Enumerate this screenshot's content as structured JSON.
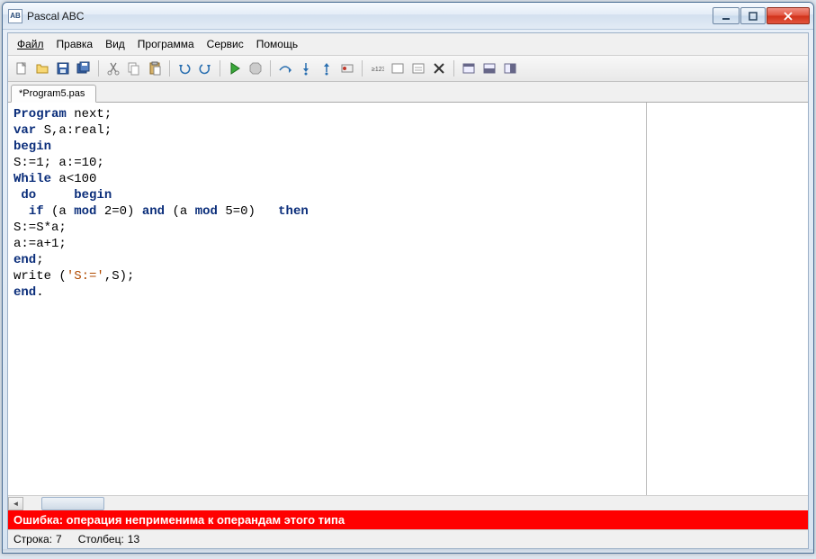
{
  "title": "Pascal ABC",
  "app_icon_text": "AB",
  "menu": {
    "file": "Файл",
    "edit": "Правка",
    "view": "Вид",
    "program": "Программа",
    "service": "Сервис",
    "help": "Помощь"
  },
  "tab": {
    "label": "*Program5.pas"
  },
  "toolbar_icons": {
    "new": "new-file-icon",
    "open": "open-folder-icon",
    "save": "save-icon",
    "saveall": "save-all-icon",
    "cut": "cut-icon",
    "copy": "copy-icon",
    "paste": "paste-icon",
    "undo": "undo-icon",
    "redo": "redo-icon",
    "run": "run-icon",
    "stop": "stop-icon",
    "stepover": "step-over-icon",
    "stepinto": "step-into-icon",
    "stepout": "step-out-icon",
    "breakpoint": "breakpoint-icon",
    "tracevar": "trace-var-icon",
    "showtextwin": "show-text-window-icon",
    "showgraphwin": "show-graph-window-icon",
    "closewins": "close-windows-icon",
    "out1": "output-window-1-icon",
    "out2": "output-window-2-icon",
    "out3": "output-window-3-icon"
  },
  "code_tokens": [
    [
      [
        "kw",
        "Program"
      ],
      [
        "",
        " next;"
      ]
    ],
    [
      [
        "kw",
        "var"
      ],
      [
        "",
        " S,a:real;"
      ]
    ],
    [
      [
        "kw",
        "begin"
      ]
    ],
    [
      [
        "",
        "S:=1; a:=10;"
      ]
    ],
    [
      [
        "kw",
        "While"
      ],
      [
        "",
        " a<100"
      ]
    ],
    [
      [
        "",
        " "
      ],
      [
        "kw",
        "do"
      ],
      [
        "",
        "     "
      ],
      [
        "kw",
        "begin"
      ]
    ],
    [
      [
        "",
        "  "
      ],
      [
        "kw",
        "if"
      ],
      [
        "",
        " (a "
      ],
      [
        "kw",
        "mod"
      ],
      [
        "",
        " 2=0) "
      ],
      [
        "kw",
        "and"
      ],
      [
        "",
        " (a "
      ],
      [
        "kw",
        "mod"
      ],
      [
        "",
        " 5=0)   "
      ],
      [
        "kw",
        "then"
      ]
    ],
    [
      [
        "",
        "S:=S*a;"
      ]
    ],
    [
      [
        "",
        "a:=a+1;"
      ]
    ],
    [
      [
        "kw",
        "end"
      ],
      [
        "",
        ";"
      ]
    ],
    [
      [
        "",
        "write ("
      ],
      [
        "str",
        "'S:='"
      ],
      [
        "",
        ",S);"
      ]
    ],
    [
      [
        "kw",
        "end"
      ],
      [
        "",
        "."
      ]
    ]
  ],
  "error": "Ошибка: операция неприменима к операндам этого типа",
  "status": {
    "line_label": "Строка:",
    "line_value": "7",
    "col_label": "Столбец:",
    "col_value": "13"
  }
}
